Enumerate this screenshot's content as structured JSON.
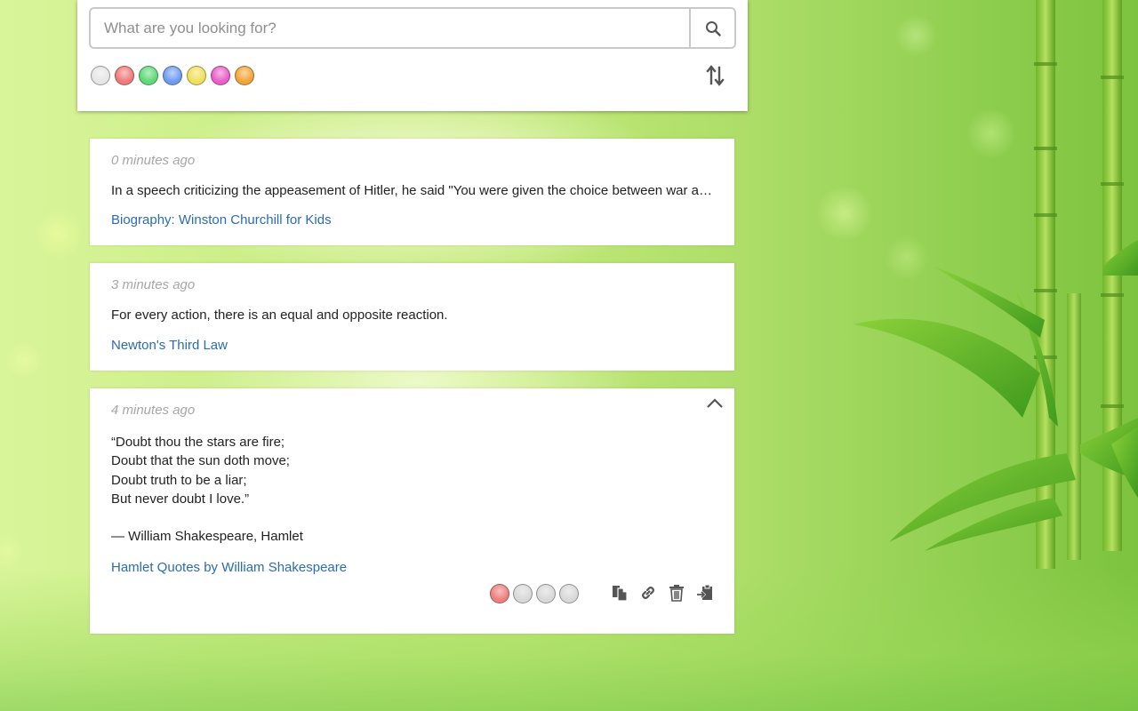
{
  "search": {
    "placeholder": "What are you looking for?"
  },
  "color_filters": [
    {
      "name": "white",
      "color": "#e6e6e6"
    },
    {
      "name": "red",
      "color": "#f07a7a"
    },
    {
      "name": "green",
      "color": "#5fd977"
    },
    {
      "name": "blue",
      "color": "#6f9cf0"
    },
    {
      "name": "yellow",
      "color": "#eee05a"
    },
    {
      "name": "pink",
      "color": "#ea5fc8"
    },
    {
      "name": "orange",
      "color": "#f2a43a"
    }
  ],
  "clips": [
    {
      "time": "0 minutes ago",
      "text": "In a speech criticizing the appeasement of Hitler, he said \"You were given the choice between war and dishonor. You chose dishonor and you will have war.\"",
      "source": "Biography: Winston Churchill for Kids"
    },
    {
      "time": "3 minutes ago",
      "text": "For every action, there is an equal and opposite reaction.",
      "source": "Newton's Third Law"
    },
    {
      "time": "4 minutes ago",
      "lines": [
        "“Doubt thou the stars are fire;",
        "Doubt that the sun doth move;",
        "Doubt truth to be a liar;",
        "But never doubt I love.”",
        "",
        "— William Shakespeare, Hamlet"
      ],
      "source": "Hamlet Quotes by William Shakespeare",
      "color_options": [
        {
          "name": "red",
          "color": "#f08080",
          "selected": true
        },
        {
          "name": "grey",
          "color": "#d9d9d9",
          "selected": false
        },
        {
          "name": "grey",
          "color": "#d9d9d9",
          "selected": false
        },
        {
          "name": "grey",
          "color": "#d9d9d9",
          "selected": false
        }
      ],
      "actions": [
        "copy-icon",
        "link-icon",
        "trash-icon",
        "paste-icon"
      ]
    }
  ],
  "colors": {
    "link": "#2b6cb0",
    "timestamp": "#a6a6a6",
    "icon": "#555555"
  }
}
